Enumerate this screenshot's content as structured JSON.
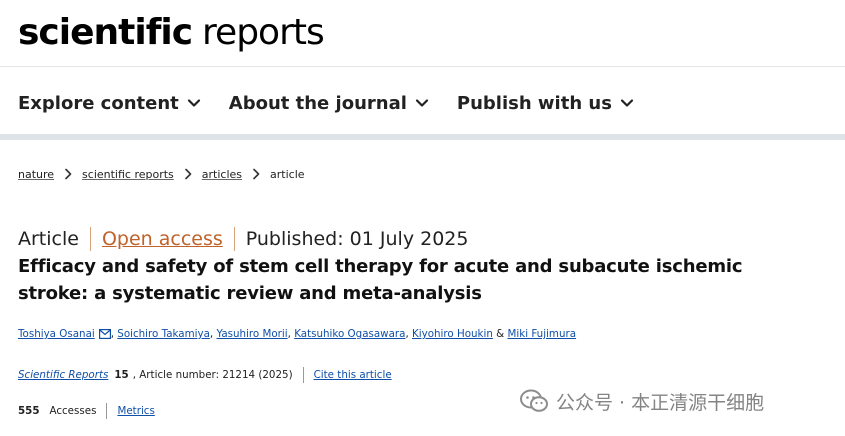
{
  "header": {
    "logo_bold": "scientific",
    "logo_light": "reports"
  },
  "nav": {
    "items": [
      {
        "label": "Explore content"
      },
      {
        "label": "About the journal"
      },
      {
        "label": "Publish with us"
      }
    ]
  },
  "breadcrumb": {
    "items": [
      "nature",
      "scientific reports",
      "articles"
    ],
    "current": "article"
  },
  "article": {
    "type": "Article",
    "access": "Open access",
    "published": "Published: 01 July 2025",
    "title": "Efficacy and safety of stem cell therapy for acute and subacute ischemic stroke: a systematic review and meta-analysis",
    "authors": [
      "Toshiya Osanai",
      "Soichiro Takamiya",
      "Yasuhiro Morii",
      "Katsuhiko Ogasawara",
      "Kiyohiro Houkin",
      "Miki Fujimura"
    ],
    "author_sep": ", ",
    "author_last_sep": " & ",
    "journal": "Scientific Reports",
    "volume": "15",
    "article_number": ", Article number: 21214 (2025)",
    "cite_label": "Cite this article",
    "accesses_count": "555",
    "accesses_label": "Accesses",
    "metrics_label": "Metrics"
  },
  "watermark": {
    "text": "公众号 · 本正清源干细胞"
  }
}
